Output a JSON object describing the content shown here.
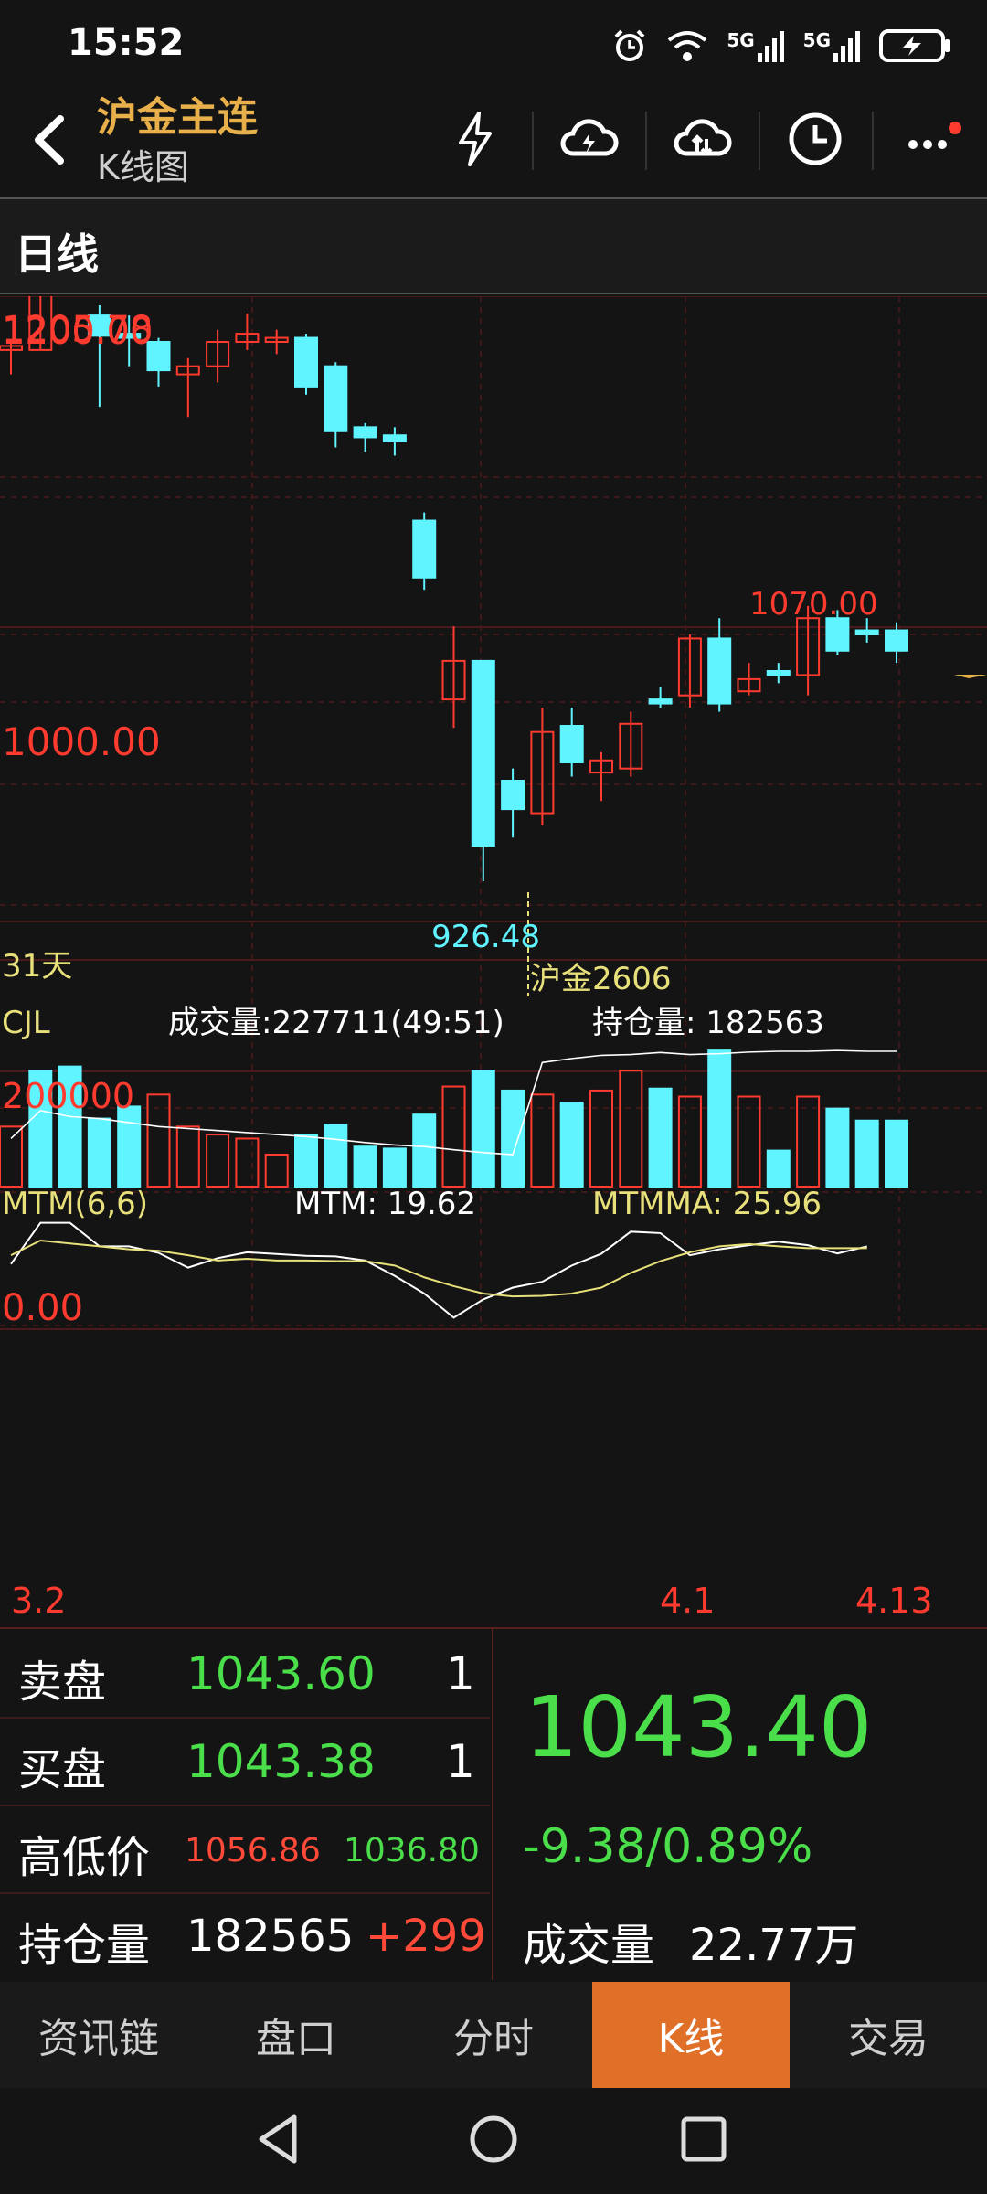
{
  "status_bar": {
    "time": "15:52",
    "net1": "5G",
    "net2": "5G"
  },
  "header": {
    "title": "沪金主连",
    "subtitle": "K线图"
  },
  "period": {
    "label": "日线"
  },
  "chart": {
    "price_label_high": "1200.00",
    "price_label_top_overlap": "1205.78",
    "price_label_mid": "1000.00",
    "marker_high": "1070.00",
    "marker_low": "926.48",
    "ma_label": "31天",
    "contract_label": "沪金2606",
    "vol_title": "CJL",
    "vol_text": "成交量:227711(49:51)",
    "oi_text": "持仓量: 182563",
    "vol_axis": "200000",
    "mtm_title": "MTM(6,6)",
    "mtm_value": "MTM: 19.62",
    "mtmma_value": "MTMMA: 25.96",
    "mtm_axis": "0.00",
    "date_start": "3.2",
    "date_mid": "4.1",
    "date_end": "4.13",
    "colors": {
      "up": "#ff3b2f",
      "down": "#5ff4ff",
      "ma": "#e8e07a",
      "white": "#ffffff"
    }
  },
  "chart_data": {
    "type": "candlestick",
    "candles": [
      {
        "o": 1188,
        "c": 1190,
        "h": 1192,
        "l": 1176
      },
      {
        "o": 1188,
        "c": 1258,
        "h": 1270,
        "l": 1188
      },
      {
        "o": 1262,
        "c": 1245,
        "h": 1268,
        "l": 1238
      },
      {
        "o": 1205,
        "c": 1195,
        "h": 1210,
        "l": 1160
      },
      {
        "o": 1196,
        "c": 1194,
        "h": 1205,
        "l": 1180
      },
      {
        "o": 1192,
        "c": 1178,
        "h": 1194,
        "l": 1170
      },
      {
        "o": 1176,
        "c": 1180,
        "h": 1184,
        "l": 1155
      },
      {
        "o": 1180,
        "c": 1192,
        "h": 1198,
        "l": 1172
      },
      {
        "o": 1192,
        "c": 1196,
        "h": 1206,
        "l": 1188
      },
      {
        "o": 1192,
        "c": 1194,
        "h": 1198,
        "l": 1186
      },
      {
        "o": 1194,
        "c": 1170,
        "h": 1196,
        "l": 1166
      },
      {
        "o": 1180,
        "c": 1148,
        "h": 1182,
        "l": 1140
      },
      {
        "o": 1150,
        "c": 1145,
        "h": 1152,
        "l": 1138
      },
      {
        "o": 1146,
        "c": 1143,
        "h": 1150,
        "l": 1136
      },
      {
        "o": 1104,
        "c": 1076,
        "h": 1108,
        "l": 1070
      },
      {
        "o": 1016,
        "c": 1035,
        "h": 1052,
        "l": 1002
      },
      {
        "o": 1035,
        "c": 944,
        "h": 1035,
        "l": 926.48
      },
      {
        "o": 976,
        "c": 962,
        "h": 982,
        "l": 948
      },
      {
        "o": 960,
        "c": 1000,
        "h": 1012,
        "l": 954
      },
      {
        "o": 1003,
        "c": 985,
        "h": 1012,
        "l": 978
      },
      {
        "o": 980,
        "c": 986,
        "h": 990,
        "l": 966
      },
      {
        "o": 982,
        "c": 1004,
        "h": 1010,
        "l": 978
      },
      {
        "o": 1016,
        "c": 1014,
        "h": 1022,
        "l": 1012
      },
      {
        "o": 1018,
        "c": 1046,
        "h": 1048,
        "l": 1012
      },
      {
        "o": 1046,
        "c": 1014,
        "h": 1056,
        "l": 1010
      },
      {
        "o": 1020,
        "c": 1026,
        "h": 1034,
        "l": 1018
      },
      {
        "o": 1030,
        "c": 1028,
        "h": 1034,
        "l": 1024
      },
      {
        "o": 1028,
        "c": 1056,
        "h": 1062,
        "l": 1018
      },
      {
        "o": 1056,
        "c": 1040,
        "h": 1060,
        "l": 1038
      },
      {
        "o": 1050,
        "c": 1048,
        "h": 1056,
        "l": 1044
      },
      {
        "o": 1050,
        "c": 1040,
        "h": 1054,
        "l": 1034
      }
    ],
    "price_range": [
      904,
      1210
    ],
    "volume": [
      {
        "v": 150000,
        "up": true
      },
      {
        "v": 290000,
        "up": false
      },
      {
        "v": 300000,
        "up": false
      },
      {
        "v": 170000,
        "up": false
      },
      {
        "v": 200000,
        "up": false
      },
      {
        "v": 230000,
        "up": true
      },
      {
        "v": 150000,
        "up": true
      },
      {
        "v": 130000,
        "up": true
      },
      {
        "v": 120000,
        "up": true
      },
      {
        "v": 80000,
        "up": true
      },
      {
        "v": 130000,
        "up": false
      },
      {
        "v": 155000,
        "up": false
      },
      {
        "v": 100000,
        "up": false
      },
      {
        "v": 95000,
        "up": false
      },
      {
        "v": 180000,
        "up": false
      },
      {
        "v": 250000,
        "up": true
      },
      {
        "v": 290000,
        "up": false
      },
      {
        "v": 240000,
        "up": false
      },
      {
        "v": 230000,
        "up": true
      },
      {
        "v": 210000,
        "up": false
      },
      {
        "v": 240000,
        "up": true
      },
      {
        "v": 290000,
        "up": true
      },
      {
        "v": 245000,
        "up": false
      },
      {
        "v": 225000,
        "up": true
      },
      {
        "v": 340000,
        "up": false
      },
      {
        "v": 225000,
        "up": true
      },
      {
        "v": 90000,
        "up": false
      },
      {
        "v": 225000,
        "up": true
      },
      {
        "v": 195000,
        "up": false
      },
      {
        "v": 165000,
        "up": false
      },
      {
        "v": 165000,
        "up": false
      }
    ],
    "volume_range": [
      0,
      370000
    ],
    "oi_line": [
      120000,
      190000,
      175000,
      170000,
      160000,
      150000,
      145000,
      140000,
      135000,
      130000,
      125000,
      118000,
      110000,
      104000,
      100000,
      92000,
      85000,
      80000,
      310000,
      320000,
      328000,
      330000,
      335000,
      330000,
      332000,
      336000,
      338000,
      338000,
      340000,
      338000,
      338000
    ],
    "mtm": [
      -40,
      100,
      100,
      20,
      20,
      -2,
      -52,
      -20,
      0,
      -6,
      -12,
      -14,
      -28,
      -80,
      -140,
      -222,
      -160,
      -120,
      -100,
      -45,
      -5,
      70,
      65,
      -10,
      10,
      24,
      36,
      24,
      -4,
      20
    ],
    "mtmma": [
      -10,
      40,
      30,
      20,
      10,
      5,
      -10,
      -28,
      -22,
      -28,
      -28,
      -30,
      -30,
      -45,
      -85,
      -115,
      -140,
      -150,
      -148,
      -140,
      -120,
      -70,
      -30,
      0,
      20,
      28,
      20,
      14,
      14,
      14
    ],
    "mtm_range": [
      -255,
      130
    ]
  },
  "quotes": {
    "ask_label": "卖盘",
    "ask_price": "1043.60",
    "ask_qty": "1",
    "bid_label": "买盘",
    "bid_price": "1043.38",
    "bid_qty": "1",
    "hl_label": "高低价",
    "high": "1056.86",
    "low": "1036.80",
    "oi_label": "持仓量",
    "oi_value": "182565",
    "oi_change": "+299",
    "last_price": "1043.40",
    "change": "-9.38/0.89%",
    "volume_label": "成交量",
    "volume_value": "22.77万"
  },
  "tabs": [
    "资讯链",
    "盘口",
    "分时",
    "K线",
    "交易"
  ],
  "active_tab": "K线"
}
